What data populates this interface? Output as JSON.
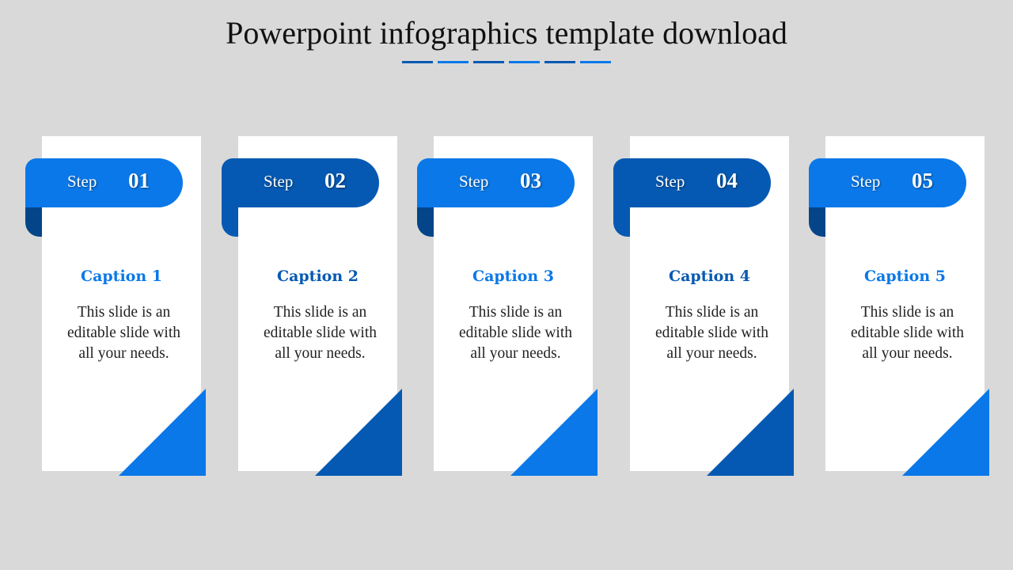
{
  "title": "Powerpoint infographics template download",
  "colors": {
    "background": "#d9d9d9",
    "bright_blue": "#0a78e8",
    "dark_blue": "#0559b2",
    "curl_dark": "#034588"
  },
  "title_dashes": [
    "dark",
    "bright",
    "dark",
    "bright",
    "dark",
    "bright"
  ],
  "steps": [
    {
      "label": "Step",
      "number": "01",
      "caption": "Caption 1",
      "text": [
        "This slide is an",
        "editable slide with",
        "all your needs."
      ],
      "theme": "bright"
    },
    {
      "label": "Step",
      "number": "02",
      "caption": "Caption 2",
      "text": [
        "This slide is an",
        "editable slide with",
        "all your needs."
      ],
      "theme": "dark"
    },
    {
      "label": "Step",
      "number": "03",
      "caption": "Caption 3",
      "text": [
        "This slide is an",
        "editable slide with",
        "all your needs."
      ],
      "theme": "bright"
    },
    {
      "label": "Step",
      "number": "04",
      "caption": "Caption 4",
      "text": [
        "This slide is an",
        "editable slide with",
        "all your needs."
      ],
      "theme": "dark"
    },
    {
      "label": "Step",
      "number": "05",
      "caption": "Caption 5",
      "text": [
        "This slide is an",
        "editable slide with",
        "all your needs."
      ],
      "theme": "bright"
    }
  ]
}
